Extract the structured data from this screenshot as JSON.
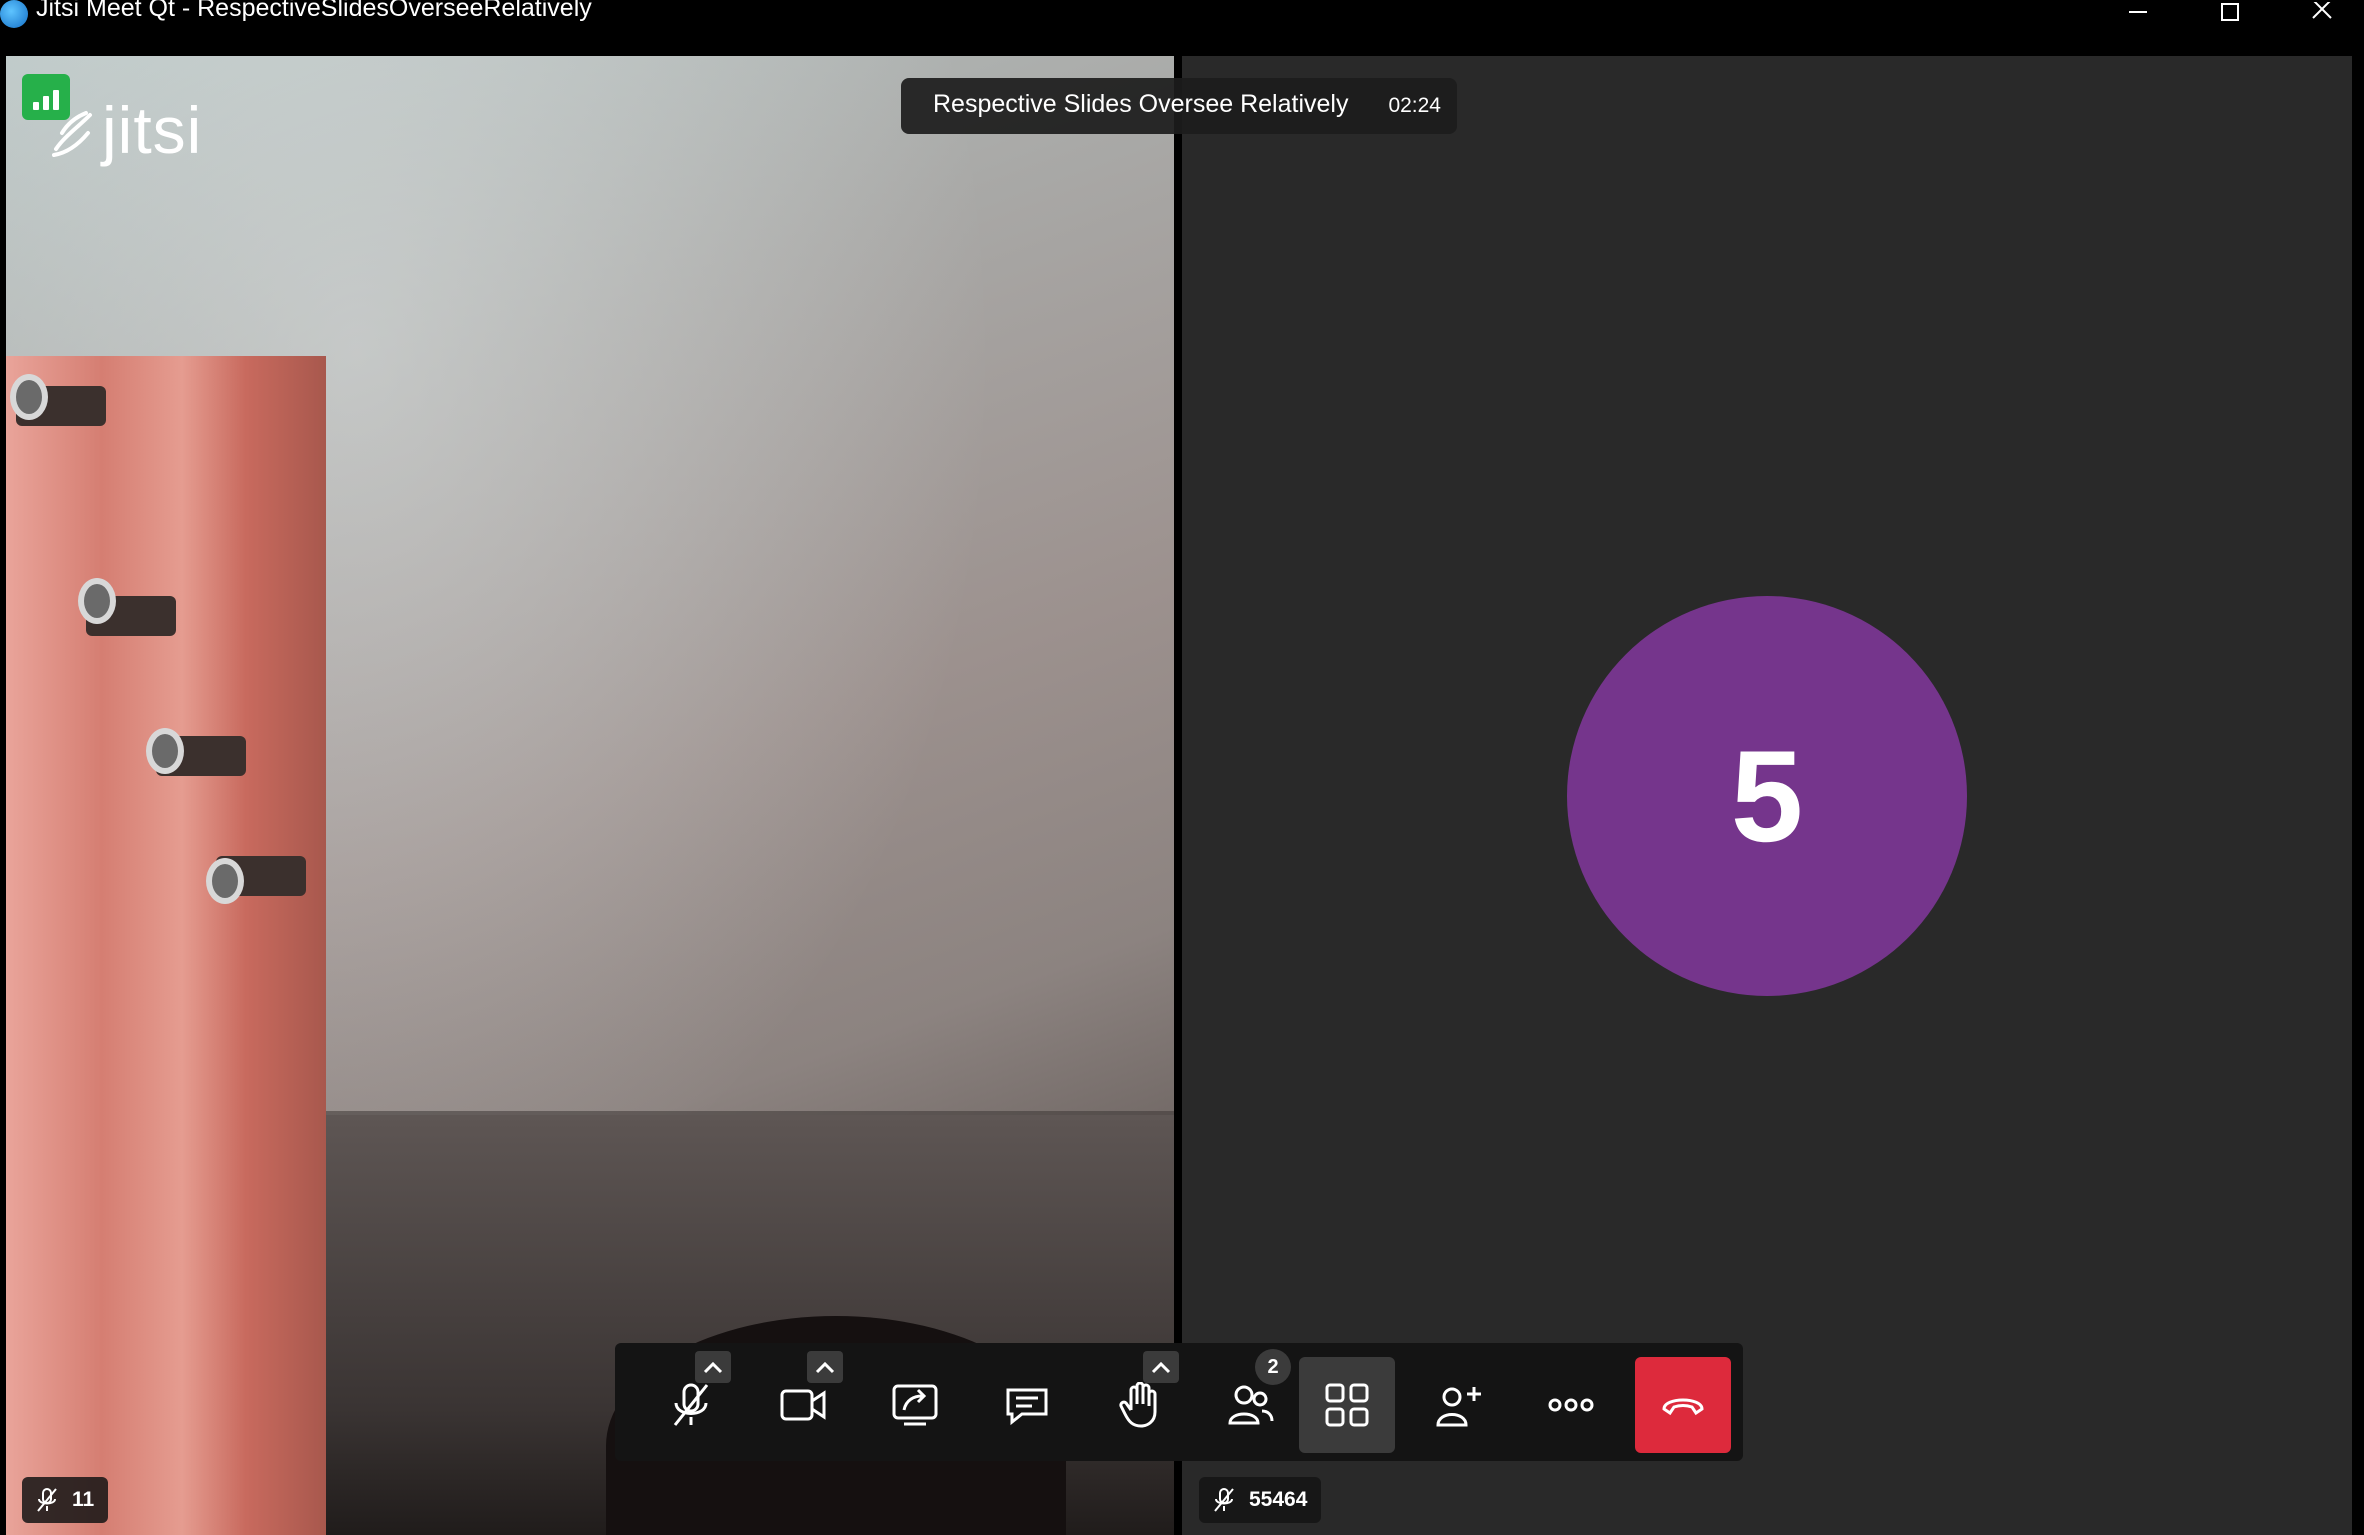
{
  "window": {
    "title": "Jitsi Meet Qt - RespectiveSlidesOverseeRelatively"
  },
  "meeting": {
    "subject": "Respective Slides Oversee Relatively",
    "timer": "02:24"
  },
  "logo": {
    "text": "jitsi"
  },
  "local_tile": {
    "name": "11",
    "muted": true
  },
  "remote_tile": {
    "name": "55464",
    "avatar_initial": "5",
    "avatar_color": "#75358c",
    "muted": true
  },
  "toolbar": {
    "participants_count": "2",
    "hangup_color": "#dd2a3c",
    "buttons": [
      "microphone-muted-icon",
      "camera-icon",
      "screen-share-icon",
      "chat-icon",
      "raise-hand-icon",
      "participants-icon",
      "tile-view-icon",
      "invite-icon",
      "more-icon",
      "hangup-icon"
    ]
  },
  "colors": {
    "connection_good": "#26b04a",
    "background": "#292929"
  }
}
